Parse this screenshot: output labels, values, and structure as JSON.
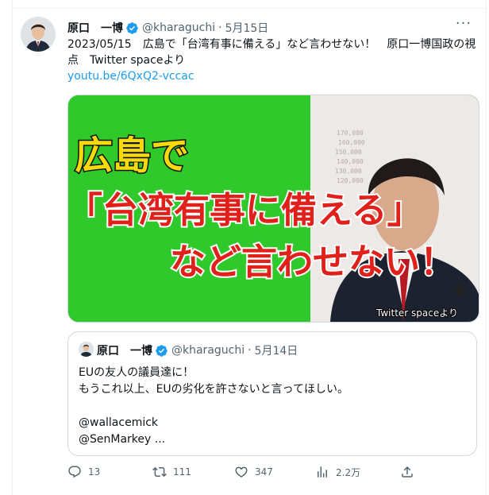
{
  "tweet": {
    "author_name": "原口",
    "author_name_2": "一博",
    "handle": "@kharaguchi",
    "separator": "·",
    "date": "5月15日",
    "more_label": "···",
    "text": "2023/05/15　広島で「台湾有事に備える」など言わせない！　原口一博国政の視点　Twitter spaceより",
    "link": "youtu.be/6QxQ2-vccac",
    "media": {
      "line1": "広島で",
      "line2": "「台湾有事に備える」",
      "line3": "など言わせない！",
      "watermark": "Twitter spaceより"
    },
    "quote": {
      "author_name": "原口",
      "author_name_2": "一博",
      "handle": "@kharaguchi",
      "separator": "·",
      "date": "5月14日",
      "lines": [
        "EUの友人の議員達に！",
        "もうこれ以上、EUの劣化を許さないと言ってほしい。",
        "",
        "@wallacemick",
        "@SenMarkey ..."
      ]
    },
    "actions": {
      "reply": {
        "icon": "reply-icon",
        "count": "13"
      },
      "retweet": {
        "icon": "retweet-icon",
        "count": "111"
      },
      "like": {
        "icon": "like-icon",
        "count": "347"
      },
      "views": {
        "icon": "views-icon",
        "count": "2.2万"
      },
      "share": {
        "icon": "share-icon"
      }
    }
  },
  "colors": {
    "link": "#1d9bf0",
    "verified_badge": "#1d9bf0",
    "secondary_text": "#536471",
    "media_green": "#2fc92b",
    "media_red_text": "#e0201a",
    "media_yellow_text": "#f5d90a"
  }
}
